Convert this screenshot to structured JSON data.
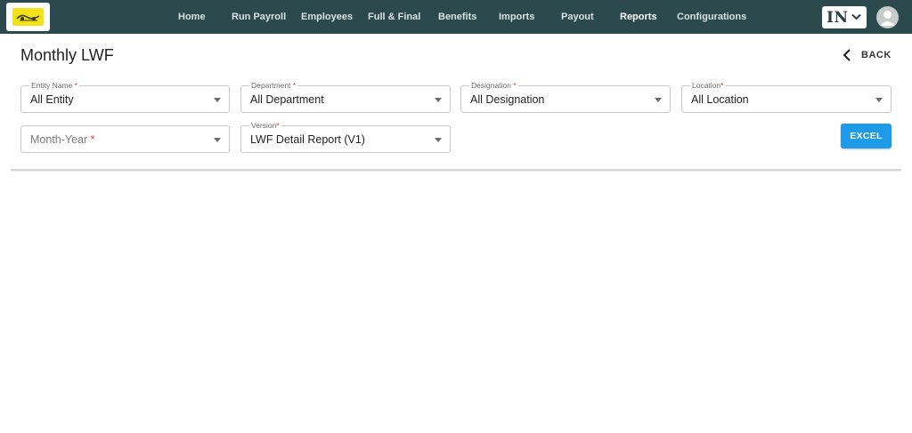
{
  "header": {
    "brand_color": "#2c4a4d",
    "nav": [
      {
        "label": "Home"
      },
      {
        "label": "Run Payroll"
      },
      {
        "label": "Employees"
      },
      {
        "label": "Full & Final"
      },
      {
        "label": "Benefits"
      },
      {
        "label": "Imports"
      },
      {
        "label": "Payout"
      },
      {
        "label": "Reports",
        "active": true
      },
      {
        "label": "Configurations"
      }
    ],
    "language": "IN",
    "icons": {
      "logo": "company-logo",
      "lang_chevron": "chevron-down-icon",
      "avatar": "user-avatar-icon"
    }
  },
  "page": {
    "title": "Monthly LWF",
    "back_label": "BACK"
  },
  "filters": {
    "entity": {
      "label": "Entity Name",
      "required": "*",
      "value": "All Entity"
    },
    "department": {
      "label": "Department",
      "required": "*",
      "value": "All Department"
    },
    "designation": {
      "label": "Designation",
      "required": "*",
      "value": "All Designation"
    },
    "location": {
      "label": "Location",
      "required": "*",
      "value": "All Location"
    },
    "month_year": {
      "placeholder": "Month-Year",
      "required": "*",
      "value": ""
    },
    "version": {
      "label": "Version",
      "required": "*",
      "value": "LWF Detail Report (V1)"
    }
  },
  "actions": {
    "excel_label": "EXCEL",
    "excel_color": "#1e9be8"
  }
}
